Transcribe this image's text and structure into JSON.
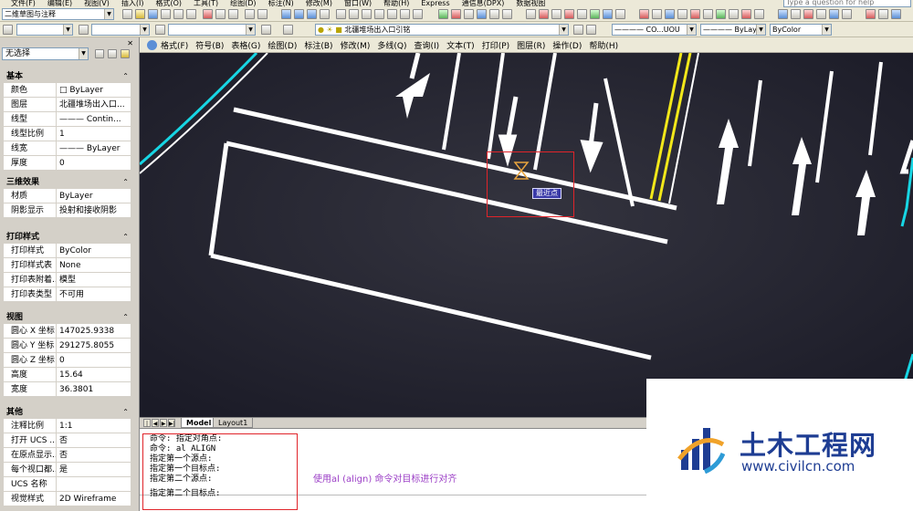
{
  "menu": {
    "items": [
      "文件(F)",
      "编辑(E)",
      "视图(V)",
      "插入(I)",
      "格式(O)",
      "工具(T)",
      "绘图(D)",
      "标注(N)",
      "修改(M)",
      "窗口(W)",
      "帮助(H)",
      "Express",
      "通信息(DPX)",
      "数据视图"
    ],
    "help_placeholder": "Type a question for help"
  },
  "toolbar": {
    "workspace": "二维草图与注释",
    "layer_combo": "北疆堆场出入口引铭",
    "linetype_combo": "———— CO...UOU",
    "lineweight_combo": "———— ByLayer",
    "color_combo": "ByColor"
  },
  "properties_panel": {
    "selection": "无选择",
    "sections": [
      {
        "title": "基本",
        "rows": [
          {
            "key": "颜色",
            "value": "□ ByLayer"
          },
          {
            "key": "图层",
            "value": "北疆堆场出入口..."
          },
          {
            "key": "线型",
            "value": "——— Contin..."
          },
          {
            "key": "线型比例",
            "value": "1"
          },
          {
            "key": "线宽",
            "value": "——— ByLayer"
          },
          {
            "key": "厚度",
            "value": "0"
          }
        ]
      },
      {
        "title": "三维效果",
        "rows": [
          {
            "key": "材质",
            "value": "ByLayer"
          },
          {
            "key": "阴影显示",
            "value": "投射和接收阴影"
          }
        ]
      },
      {
        "title": "打印样式",
        "rows": [
          {
            "key": "打印样式",
            "value": "ByColor"
          },
          {
            "key": "打印样式表",
            "value": "None"
          },
          {
            "key": "打印表附着...",
            "value": "模型"
          },
          {
            "key": "打印表类型",
            "value": "不可用"
          }
        ]
      },
      {
        "title": "视图",
        "rows": [
          {
            "key": "圆心 X 坐标",
            "value": "147025.9338"
          },
          {
            "key": "圆心 Y 坐标",
            "value": "291275.8055"
          },
          {
            "key": "圆心 Z 坐标",
            "value": "0"
          },
          {
            "key": "高度",
            "value": "15.64"
          },
          {
            "key": "宽度",
            "value": "36.3801"
          }
        ]
      },
      {
        "title": "其他",
        "rows": [
          {
            "key": "注释比例",
            "value": "1:1"
          },
          {
            "key": "打开 UCS ...",
            "value": "否"
          },
          {
            "key": "在原点显示...",
            "value": "否"
          },
          {
            "key": "每个视口都...",
            "value": "是"
          },
          {
            "key": "UCS 名称",
            "value": ""
          },
          {
            "key": "视觉样式",
            "value": "2D Wireframe"
          }
        ]
      }
    ]
  },
  "draw_menu": [
    "格式(F)",
    "符号(B)",
    "表格(G)",
    "绘图(D)",
    "标注(B)",
    "修改(M)",
    "多线(Q)",
    "查询(I)",
    "文本(T)",
    "打印(P)",
    "图层(R)",
    "操作(D)",
    "帮助(H)"
  ],
  "canvas": {
    "snap_tooltip": "最近点",
    "colors": {
      "background": "#22222f",
      "road_marking": "#ffffff",
      "edge_line": "#17d6e4",
      "center_line": "#f2e81a",
      "highlight": "#e0242a"
    }
  },
  "tabs": {
    "model": "Model",
    "layout": "Layout1"
  },
  "command_lines": [
    "命令: 指定对角点:",
    "命令: al ALIGN",
    "指定第一个源点:",
    "指定第一个目标点:",
    "指定第二个源点:",
    "指定第二个目标点:"
  ],
  "annotation": "使用al (align) 命令对目标进行对齐",
  "watermark": {
    "title": "土木工程网",
    "url": "www.civilcn.com"
  }
}
